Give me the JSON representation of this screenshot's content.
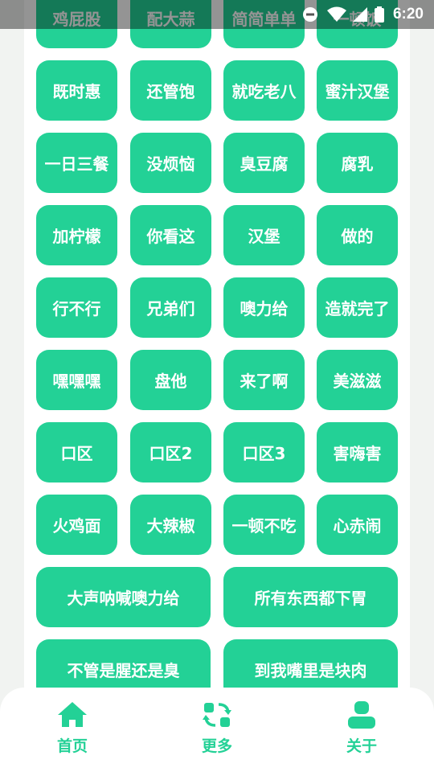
{
  "status_bar": {
    "time": "6:20"
  },
  "buttons": [
    [
      "鸡屁股",
      "配大蒜",
      "简简单单",
      "一顿饭"
    ],
    [
      "既时惠",
      "还管饱",
      "就吃老八",
      "蜜汁汉堡"
    ],
    [
      "一日三餐",
      "没烦恼",
      "臭豆腐",
      "腐乳"
    ],
    [
      "加柠檬",
      "你看这",
      "汉堡",
      "做的"
    ],
    [
      "行不行",
      "兄弟们",
      "噢力给",
      "造就完了"
    ],
    [
      "嘿嘿嘿",
      "盘他",
      "来了啊",
      "美滋滋"
    ],
    [
      "口区",
      "口区2",
      "口区3",
      "害嗨害"
    ],
    [
      "火鸡面",
      "大辣椒",
      "一顿不吃",
      "心赤闹"
    ],
    [
      "大声呐喊噢力给",
      "所有东西都下胃"
    ],
    [
      "不管是腥还是臭",
      "到我嘴里是块肉"
    ]
  ],
  "nav": {
    "home": "首页",
    "more": "更多",
    "about": "关于"
  },
  "colors": {
    "accent": "#23d196",
    "background": "#f1f3f1",
    "card": "#ffffff"
  }
}
